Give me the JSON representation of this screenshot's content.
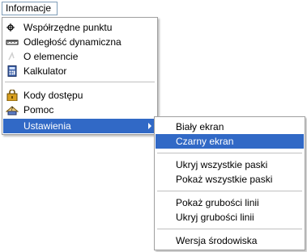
{
  "menubar": {
    "title": "Informacje"
  },
  "menu": {
    "items": [
      {
        "label": "Współrzędne punktu",
        "icon": "crosshair-icon"
      },
      {
        "label": "Odległość dynamiczna",
        "icon": "ruler-icon"
      },
      {
        "label": "O elemencie",
        "icon": "info-element-icon"
      },
      {
        "label": "Kalkulator",
        "icon": "calculator-icon"
      },
      {
        "label": "Kody dostępu",
        "icon": "lock-icon"
      },
      {
        "label": "Pomoc",
        "icon": "help-icon"
      },
      {
        "label": "Ustawienia",
        "icon": ""
      }
    ]
  },
  "submenu": {
    "items": [
      {
        "label": "Biały ekran"
      },
      {
        "label": "Czarny ekran"
      },
      {
        "label": "Ukryj wszystkie paski"
      },
      {
        "label": "Pokaż wszystkie paski"
      },
      {
        "label": "Pokaż grubości linii"
      },
      {
        "label": "Ukryj grubości linii"
      },
      {
        "label": "Wersja środowiska"
      }
    ]
  },
  "colors": {
    "highlight": "#3169c6",
    "menu_border": "#a0a0a0"
  }
}
